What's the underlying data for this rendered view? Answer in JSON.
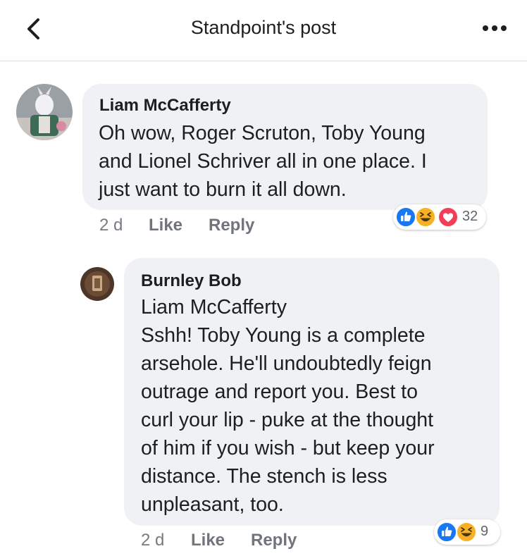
{
  "header": {
    "title": "Standpoint's post",
    "back_icon": "chevron-left-icon",
    "menu_icon": "more-horizontal-icon"
  },
  "comments": [
    {
      "author": "Liam McCafferty",
      "lines": [
        "Oh wow, Roger Scruton, Toby Young",
        "and Lionel Schriver all in one place. I",
        "just want to burn it all down."
      ],
      "time": "2 d",
      "like_label": "Like",
      "reply_label": "Reply",
      "reactions": [
        "like",
        "haha",
        "love"
      ],
      "reaction_count": "32"
    },
    {
      "author": "Burnley Bob",
      "lines": [
        "Liam McCafferty",
        "Sshh! Toby Young is a complete",
        "arsehole. He'll undoubtedly feign",
        "outrage and report you. Best to",
        "curl your lip - puke at the thought",
        "of him if you wish - but keep your",
        "distance. The stench is less",
        "unpleasant, too."
      ],
      "time": "2 d",
      "like_label": "Like",
      "reply_label": "Reply",
      "reactions": [
        "like",
        "haha"
      ],
      "reaction_count": "9"
    }
  ],
  "colors": {
    "like": "#1877f2",
    "love": "#f33e58",
    "haha": "#f7b125",
    "bubble": "#f0f1f4"
  }
}
